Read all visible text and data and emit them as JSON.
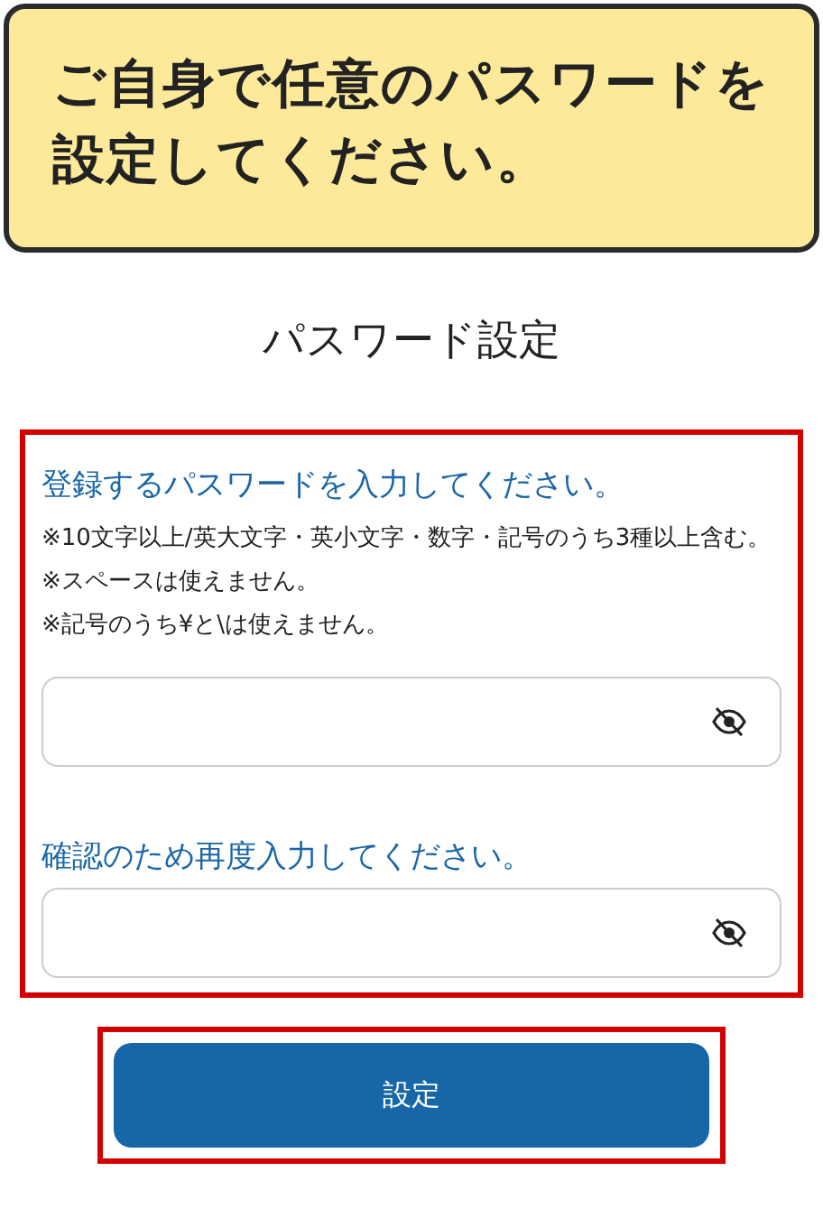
{
  "banner": {
    "text": "ご自身で任意のパスワードを設定してください。"
  },
  "title": "パスワード設定",
  "form": {
    "highlighted": true,
    "password_label": "登録するパスワードを入力してください。",
    "notes": [
      "※10文字以上/英大文字・英小文字・数字・記号のうち3種以上含む。",
      "※スペースは使えません。",
      "※記号のうち¥と\\は使えません。"
    ],
    "confirm_label": "確認のため再度入力してください。"
  },
  "submit": {
    "label": "設定",
    "highlighted": true
  }
}
